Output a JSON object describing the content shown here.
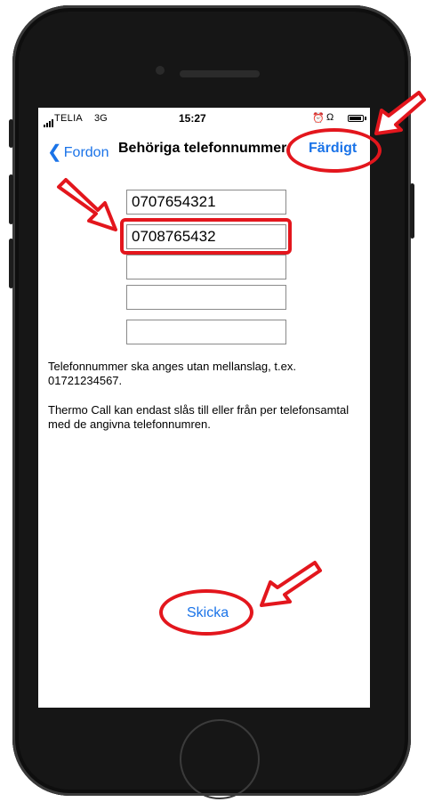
{
  "status_bar": {
    "carrier": "TELIA",
    "network": "3G",
    "time": "15:27",
    "icons": [
      "signal-icon",
      "alarm-icon",
      "headphones-icon",
      "battery-icon"
    ]
  },
  "nav": {
    "back_label": "Fordon",
    "title": "Behöriga telefonnummer",
    "done_label": "Färdigt"
  },
  "phone_fields": [
    {
      "value": "0707654321"
    },
    {
      "value": "0708765432"
    },
    {
      "value": ""
    },
    {
      "value": ""
    },
    {
      "value": ""
    }
  ],
  "help_text": [
    "Telefonnummer ska anges utan mellanslag, t.ex. 01721234567.",
    "Thermo Call kan endast slås till eller från per telefonsamtal med de angivna telefonnumren."
  ],
  "send_label": "Skicka",
  "colors": {
    "accent": "#1a73e8",
    "annotation": "#e3161d"
  }
}
